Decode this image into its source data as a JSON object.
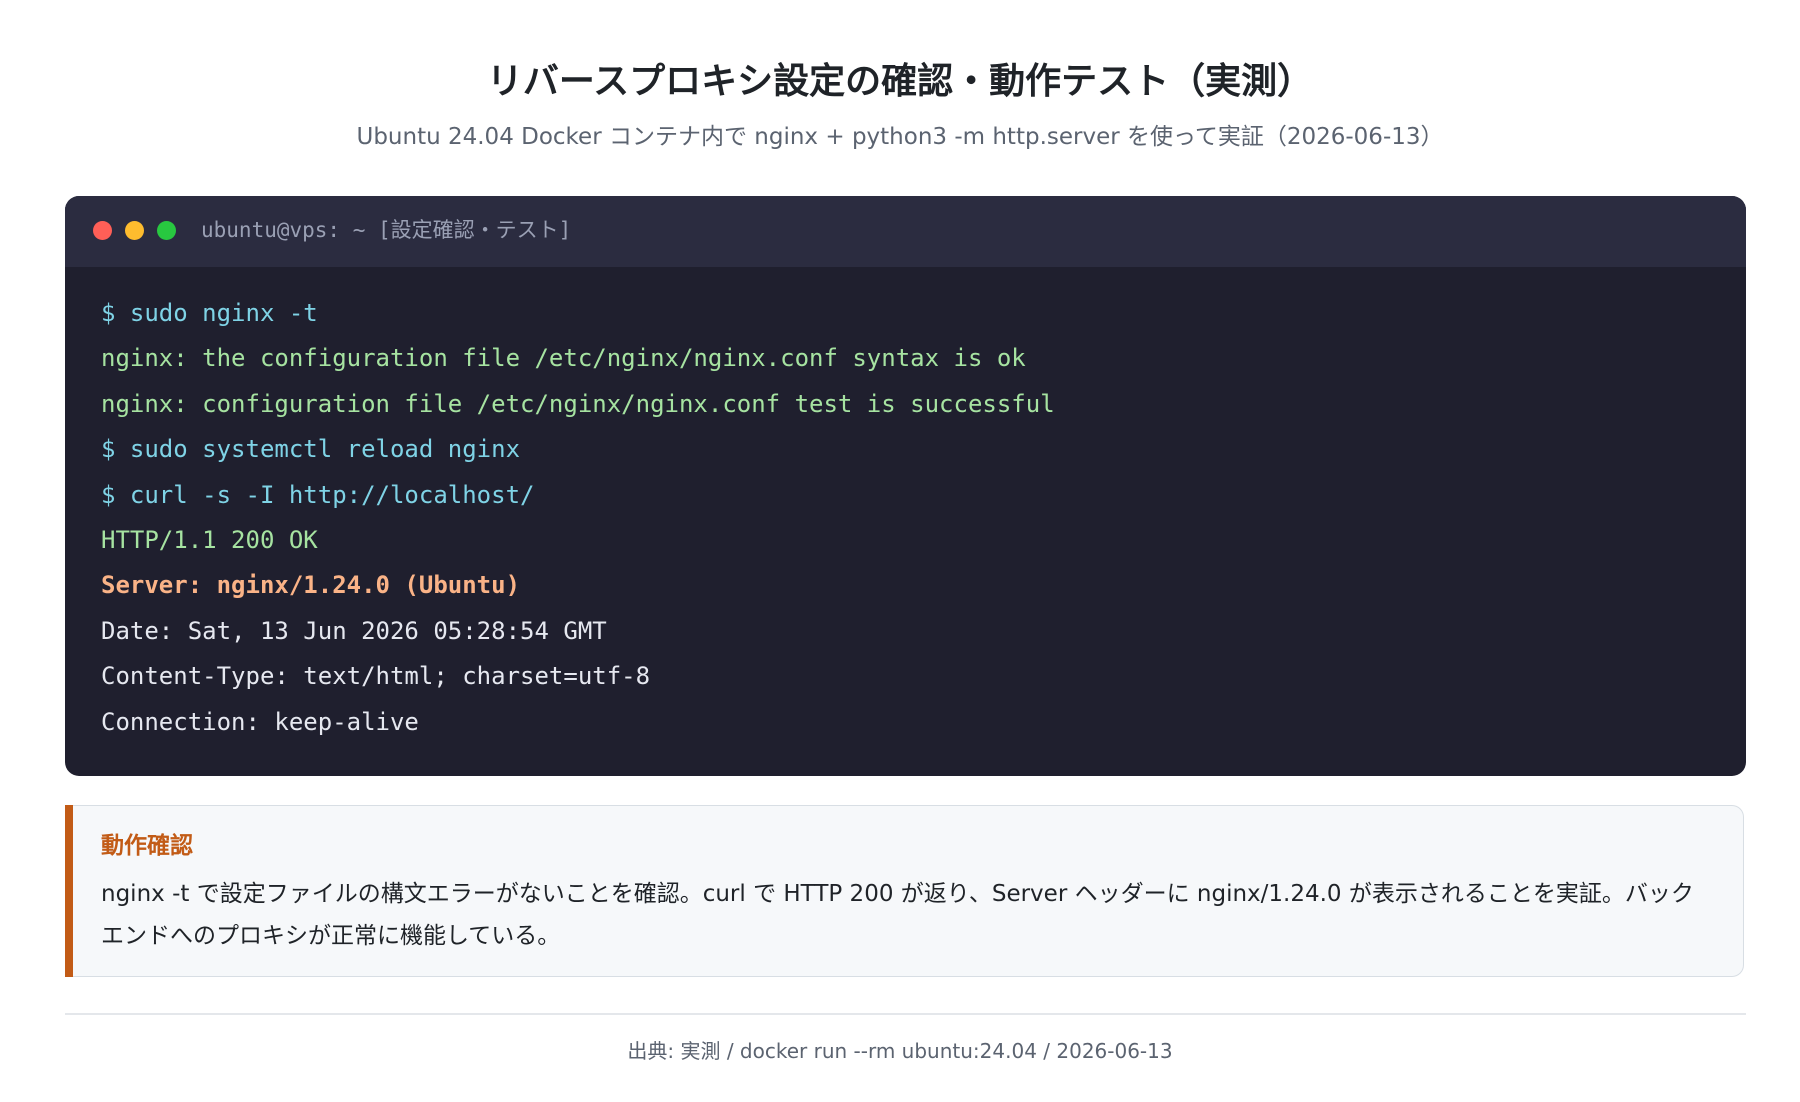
{
  "header": {
    "title": "リバースプロキシ設定の確認・動作テスト（実測）",
    "subtitle": "Ubuntu 24.04 Docker コンテナ内で nginx + python3 -m http.server を使って実証（2026-06-13）"
  },
  "terminal": {
    "window_title": "ubuntu@vps: ~ [設定確認・テスト]",
    "lines": [
      {
        "text": "$ sudo nginx -t",
        "kind": "command"
      },
      {
        "text": "nginx: the configuration file /etc/nginx/nginx.conf syntax is ok",
        "kind": "success"
      },
      {
        "text": "nginx: configuration file /etc/nginx/nginx.conf test is successful",
        "kind": "success"
      },
      {
        "text": "$ sudo systemctl reload nginx",
        "kind": "command"
      },
      {
        "text": "$ curl -s -I http://localhost/",
        "kind": "command"
      },
      {
        "text": "HTTP/1.1 200 OK",
        "kind": "success"
      },
      {
        "text": "Server: nginx/1.24.0 (Ubuntu)",
        "kind": "highlight"
      },
      {
        "text": "Date: Sat, 13 Jun 2026 05:28:54 GMT",
        "kind": "plain"
      },
      {
        "text": "Content-Type: text/html; charset=utf-8",
        "kind": "plain"
      },
      {
        "text": "Connection: keep-alive",
        "kind": "plain"
      }
    ]
  },
  "note": {
    "heading": "動作確認",
    "text": "nginx -t で設定ファイルの構文エラーがないことを確認。curl で HTTP 200 が返り、Server ヘッダーに nginx/1.24.0 が表示されることを実証。バックエンドへのプロキシが正常に機能している。"
  },
  "footer": {
    "source": "出典: 実測 / docker run --rm ubuntu:24.04 / 2026-06-13"
  },
  "colors": {
    "terminal_bg": "#1f1f2e",
    "command": "#7fd3e6",
    "success": "#a6e3a1",
    "highlight": "#fab387",
    "accent": "#c25b16"
  },
  "icons": [
    "close-dot-icon",
    "minimize-dot-icon",
    "maximize-dot-icon"
  ]
}
